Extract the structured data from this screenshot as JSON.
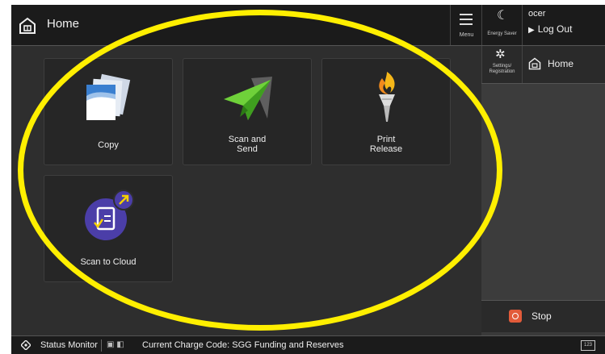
{
  "header": {
    "title": "Home",
    "menu_label": "Menu"
  },
  "side": {
    "energy_saver_label": "Energy Saver",
    "user_name": "ocer",
    "logout_label": "Log Out",
    "settings_label_line1": "Settings/",
    "settings_label_line2": "Registration",
    "home_label": "Home",
    "stop_label": "Stop",
    "keyboard_label": "123"
  },
  "tiles": [
    {
      "label": "Copy",
      "icon": "copy-icon"
    },
    {
      "label_line1": "Scan and",
      "label_line2": "Send",
      "icon": "scan-send-icon"
    },
    {
      "label_line1": "Print",
      "label_line2": "Release",
      "icon": "print-release-icon"
    },
    {
      "label": "Scan to Cloud",
      "icon": "scan-to-cloud-icon"
    }
  ],
  "status": {
    "monitor_label": "Status Monitor",
    "charge_code": "Current Charge Code: SGG Funding and Reserves"
  },
  "colors": {
    "highlight": "#ffef00",
    "stop": "#e25b3a",
    "background": "#2e2e2e"
  }
}
